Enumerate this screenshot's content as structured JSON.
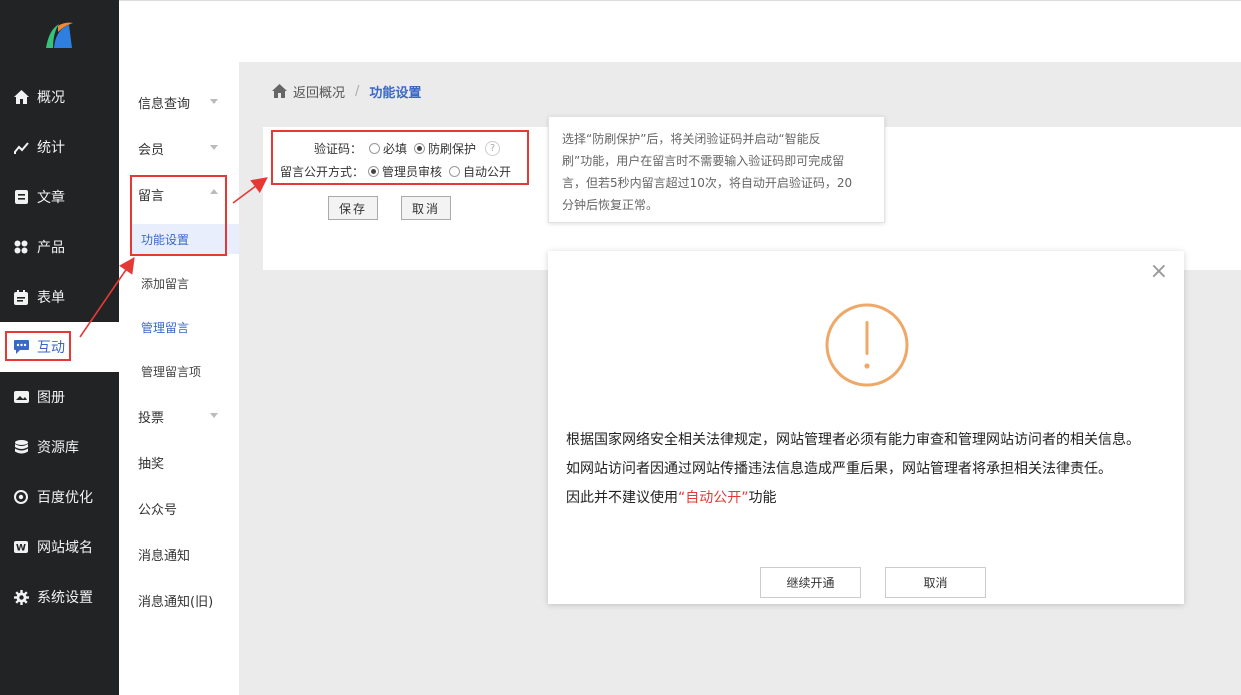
{
  "sidebar": {
    "items": [
      {
        "label": "概况",
        "icon": "home-icon"
      },
      {
        "label": "统计",
        "icon": "stats-icon"
      },
      {
        "label": "文章",
        "icon": "article-icon"
      },
      {
        "label": "产品",
        "icon": "product-icon"
      },
      {
        "label": "表单",
        "icon": "form-icon"
      },
      {
        "label": "互动",
        "icon": "chat-icon"
      },
      {
        "label": "图册",
        "icon": "gallery-icon"
      },
      {
        "label": "资源库",
        "icon": "database-icon"
      },
      {
        "label": "百度优化",
        "icon": "seo-icon"
      },
      {
        "label": "网站域名",
        "icon": "domain-icon"
      },
      {
        "label": "系统设置",
        "icon": "gear-icon"
      }
    ]
  },
  "submenu": {
    "items": [
      "信息查询",
      "会员",
      "留言",
      "投票",
      "抽奖",
      "公众号",
      "消息通知",
      "消息通知(旧)"
    ],
    "children": [
      "功能设置",
      "添加留言",
      "管理留言",
      "管理留言项"
    ]
  },
  "breadcrumb": {
    "back": "返回概况",
    "separator": "/",
    "current": "功能设置"
  },
  "form": {
    "captcha_label": "验证码：",
    "captcha_opt1": "必填",
    "captcha_opt2": "防刷保护",
    "help": "?",
    "public_label": "留言公开方式：",
    "public_opt1": "管理员审核",
    "public_opt2": "自动公开",
    "save": "保存",
    "cancel": "取消"
  },
  "tooltip": {
    "line1": "选择“防刷保护”后，将关闭验证码并启动“智能反",
    "line2": "刷”功能，用户在留言时不需要输入验证码即可完成留",
    "line3": "言，但若5秒内留言超过10次，将自动开启验证码，20",
    "line4": "分钟后恢复正常。"
  },
  "modal": {
    "close": "×",
    "line1": "根据国家网络安全相关法律规定，网站管理者必须有能力审查和管理网站访问者的相关信息。",
    "line2": "如网站访问者因通过网站传播违法信息造成严重后果，网站管理者将承担相关法律责任。",
    "line3_prefix": "因此并不建议使用",
    "line3_red": "“自动公开”",
    "line3_suffix": "功能",
    "confirm": "继续开通",
    "cancel": "取消"
  },
  "colors": {
    "accent": "#3a68c7",
    "highlight": "#e53935",
    "warning": "#f0a868",
    "sidebar": "#222325"
  }
}
